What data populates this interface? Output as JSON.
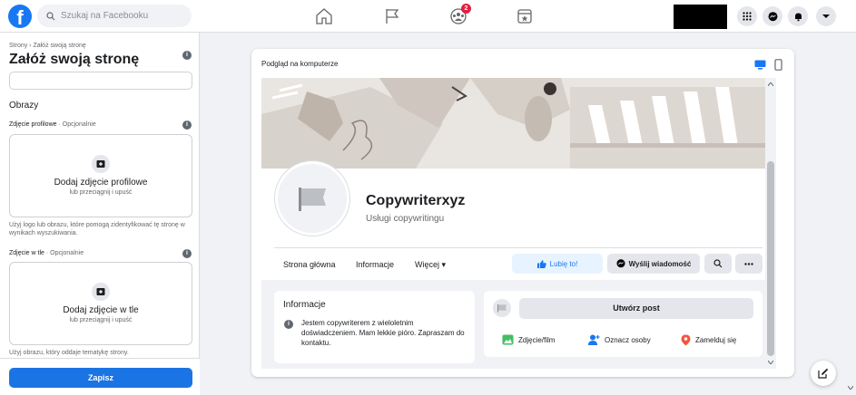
{
  "topbar": {
    "search_placeholder": "Szukaj na Facebooku",
    "groups_badge": "2",
    "brand_color": "#1877f2"
  },
  "left": {
    "breadcrumb": "Strony › Załóż swoją stronę",
    "title": "Załóż swoją stronę",
    "images_section": "Obrazy",
    "profile_label": "Zdjęcie profilowe",
    "profile_optional": " · Opcjonalnie",
    "profile_add": "Dodaj zdjęcie profilowe",
    "profile_drag": "lub przeciągnij i upuść",
    "profile_help": "Użyj logo lub obrazu, które pomogą zidentyfikować tę stronę w wynikach wyszukiwania.",
    "cover_label": "Zdjęcie w tle",
    "cover_optional": " · Opcjonalnie",
    "cover_add": "Dodaj zdjęcie w tle",
    "cover_drag": "lub przeciągnij i upuść",
    "cover_help": "Użyj obrazu, który oddaje tematykę strony.",
    "save": "Zapisz"
  },
  "preview": {
    "title": "Podgląd na komputerze",
    "page_name": "Copywriterxyz",
    "page_category": "Usługi copywritingu",
    "tabs": [
      "Strona główna",
      "Informacje",
      "Więcej ▾"
    ],
    "like": "Lubię to!",
    "message": "Wyślij wiadomość",
    "info_title": "Informacje",
    "info_text": "Jestem copywriterem z wieloletnim doświadczeniem. Mam lekkie pióro. Zapraszam do kontaktu.",
    "create_post": "Utwórz post",
    "photo_video": "Zdjęcie/film",
    "tag_people": "Oznacz osoby",
    "check_in": "Zamelduj się"
  }
}
